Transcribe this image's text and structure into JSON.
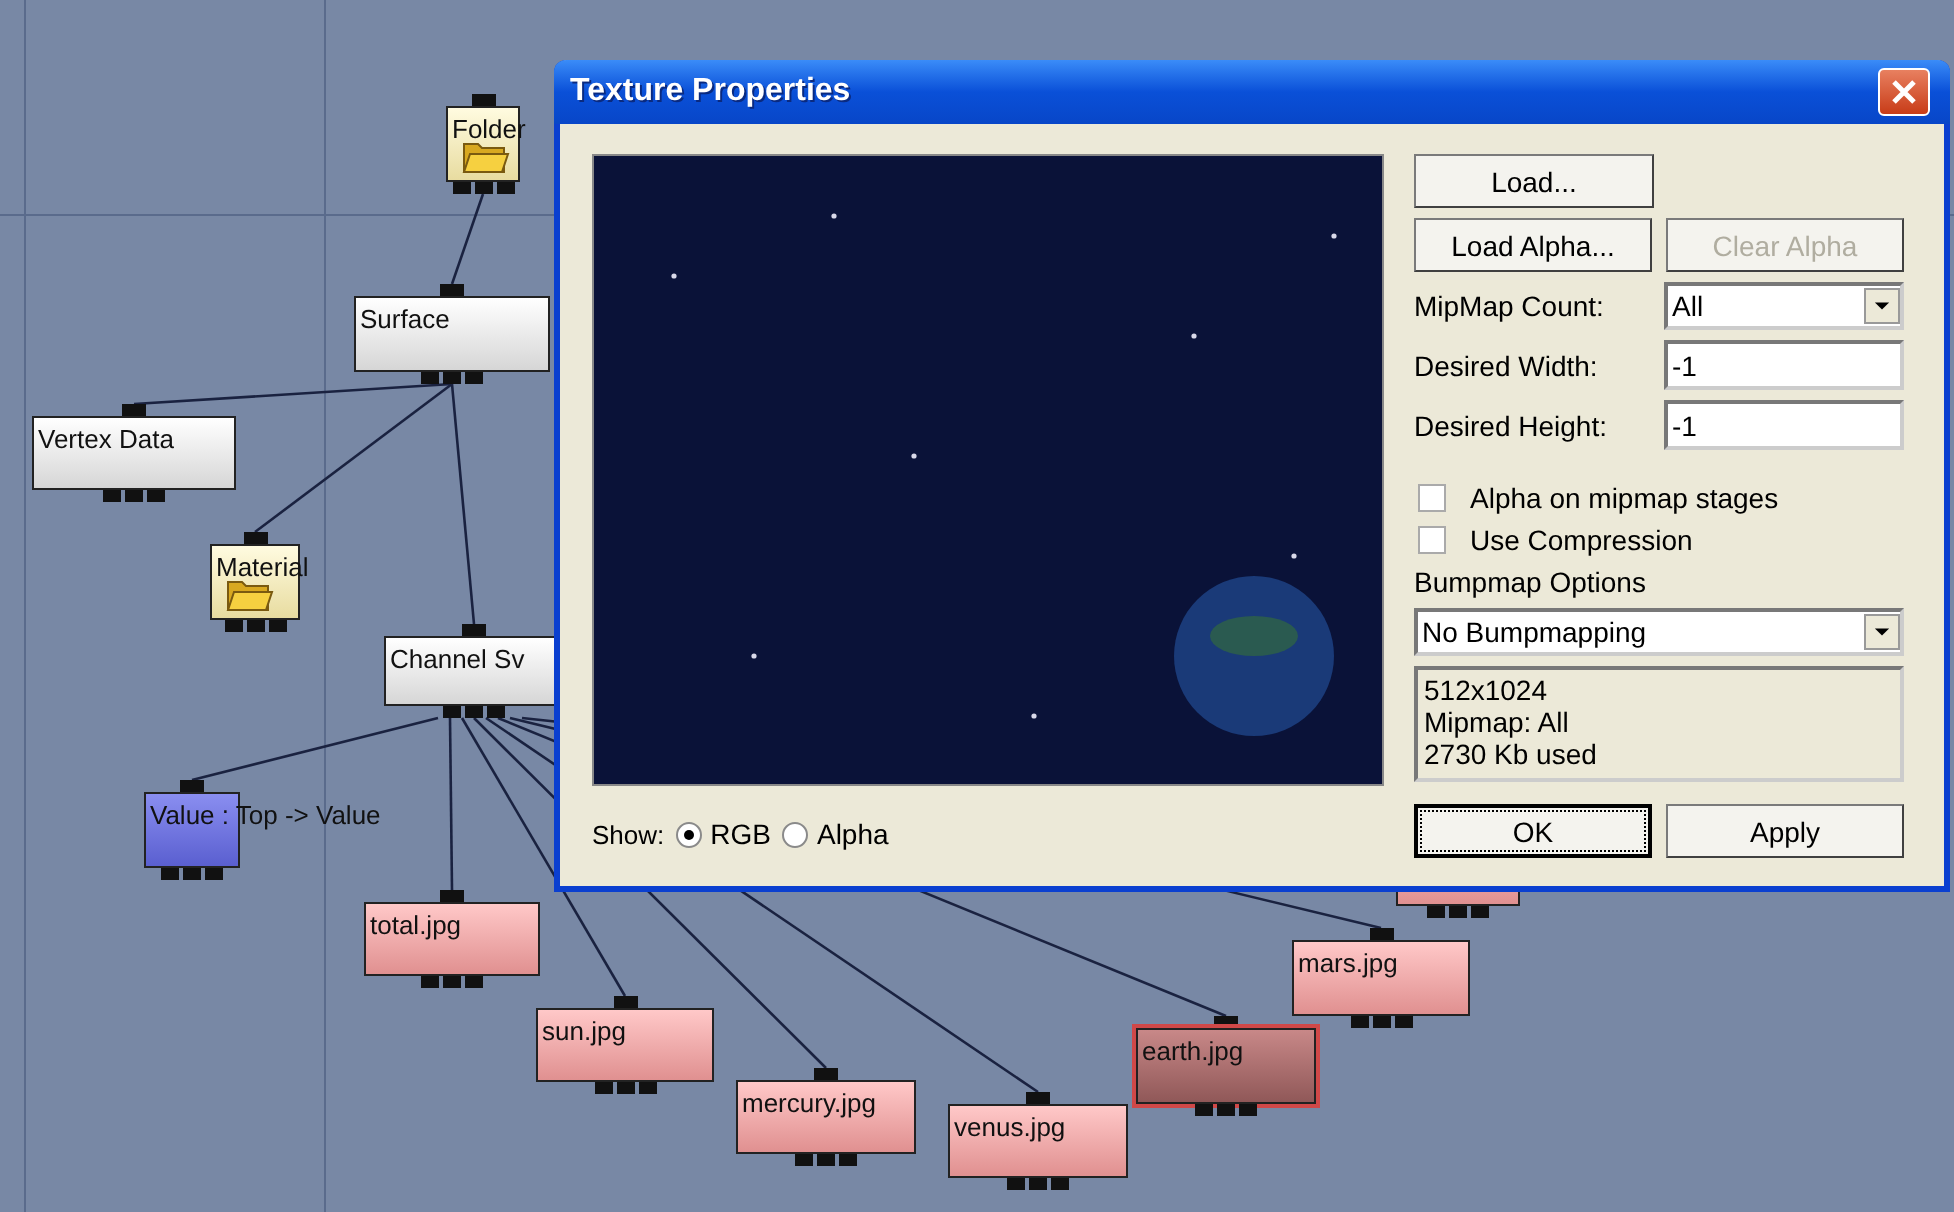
{
  "graph": {
    "nodes": [
      {
        "kind": "folder",
        "label": "Folder",
        "selected": false
      },
      {
        "kind": "process",
        "label": "Surface",
        "selected": false
      },
      {
        "kind": "process",
        "label": "Vertex Data",
        "selected": false
      },
      {
        "kind": "folder",
        "label": "Material",
        "selected": false
      },
      {
        "kind": "process",
        "label": "Channel Sv",
        "selected": false
      },
      {
        "kind": "value",
        "label": "Value : Top -> Value",
        "selected": false
      },
      {
        "kind": "file",
        "label": "total.jpg",
        "selected": false
      },
      {
        "kind": "file",
        "label": "sun.jpg",
        "selected": false
      },
      {
        "kind": "file",
        "label": "mercury.jpg",
        "selected": false
      },
      {
        "kind": "file",
        "label": "venus.jpg",
        "selected": false
      },
      {
        "kind": "file",
        "label": "earth.jpg",
        "selected": true
      },
      {
        "kind": "file",
        "label": "mars.jpg",
        "selected": false
      },
      {
        "kind": "file",
        "selected": false
      }
    ]
  },
  "dialog": {
    "title": "Texture Properties",
    "show_label": "Show:",
    "show_options": [
      {
        "label": "RGB",
        "selected": true
      },
      {
        "label": "Alpha",
        "selected": false
      }
    ],
    "load_button": {
      "label": "Load...",
      "disabled": false
    },
    "load_alpha_button": {
      "label": "Load Alpha...",
      "disabled": false
    },
    "clear_alpha_button": {
      "label": "Clear Alpha",
      "disabled": true
    },
    "mipmap_count": {
      "label": "MipMap Count:",
      "value": "All"
    },
    "desired_width": {
      "label": "Desired Width:",
      "value": "-1"
    },
    "desired_height": {
      "label": "Desired Height:",
      "value": "-1"
    },
    "checkboxes": [
      {
        "label": "Alpha on mipmap stages",
        "checked": false
      },
      {
        "label": "Use Compression",
        "checked": false
      }
    ],
    "bumpmap": {
      "label": "Bumpmap Options",
      "value": "No Bumpmapping"
    },
    "info_lines": [
      "512x1024",
      "Mipmap: All",
      "2730 Kb used"
    ],
    "ok_button": {
      "label": "OK",
      "disabled": false
    },
    "apply_button": {
      "label": "Apply",
      "disabled": false
    }
  }
}
